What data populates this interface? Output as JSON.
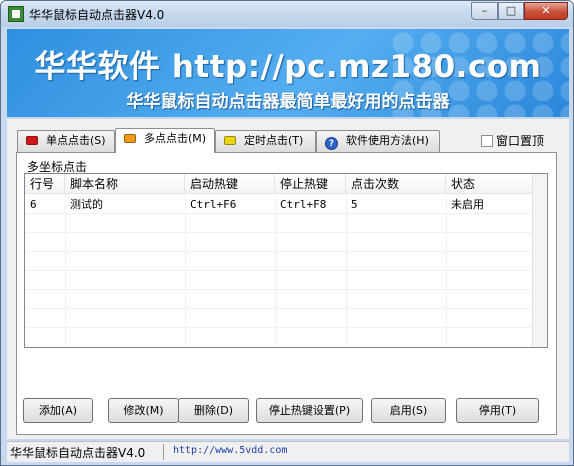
{
  "window": {
    "title": "华华鼠标自动点击器V4.0",
    "minimize": "–",
    "maximize": "□",
    "close": "✕"
  },
  "banner": {
    "title": "华华软件 http://pc.mz180.com",
    "subtitle": "华华鼠标自动点击器最简单最好用的点击器"
  },
  "tabs": [
    {
      "label": "单点点击(S)",
      "icon": "red-indicator"
    },
    {
      "label": "多点点击(M)",
      "icon": "orange-indicator",
      "active": true
    },
    {
      "label": "定时点击(T)",
      "icon": "yellow-indicator"
    },
    {
      "label": "软件使用方法(H)",
      "icon": "help-icon"
    }
  ],
  "topmost": {
    "label": "窗口置顶",
    "checked": false
  },
  "group": {
    "label": "多坐标点击"
  },
  "table": {
    "columns": [
      "行号",
      "脚本名称",
      "启动热键",
      "停止热键",
      "点击次数",
      "状态"
    ],
    "rows": [
      [
        "6",
        "测试的",
        "Ctrl+F6",
        "Ctrl+F8",
        "5",
        "未启用"
      ]
    ]
  },
  "buttons": {
    "add": "添加(A)",
    "edit": "修改(M)",
    "delete": "删除(D)",
    "stop_hotkey": "停止热键设置(P)",
    "enable": "启用(S)",
    "disable": "停用(T)"
  },
  "status": {
    "left": "华华鼠标自动点击器V4.0",
    "url": "http://www.5vdd.com"
  },
  "colors": {
    "banner": "#3a98e4",
    "title_bar": "#c7d9ee",
    "close_button": "#c8503a",
    "status_url": "#1b3fa8"
  }
}
